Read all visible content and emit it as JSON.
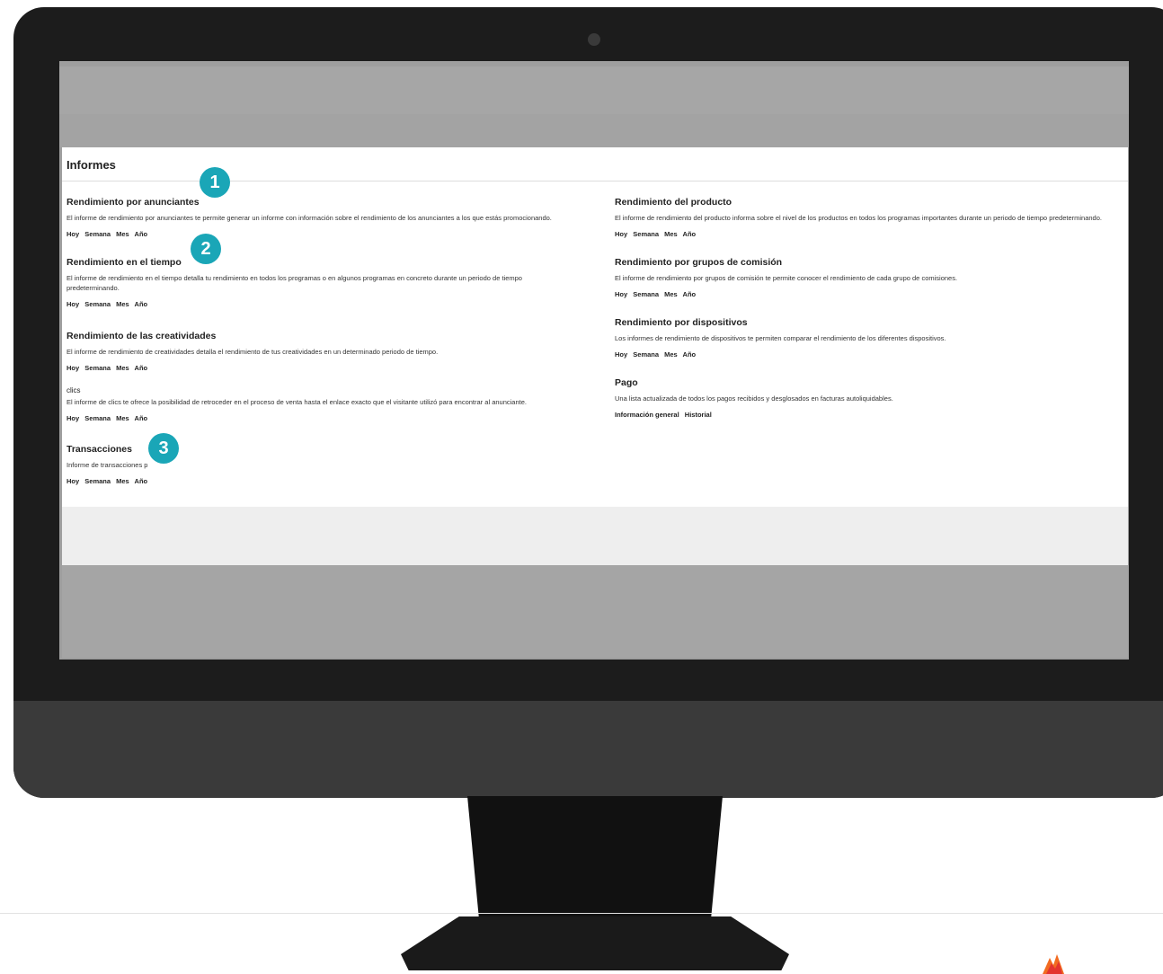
{
  "colors": {
    "callout": "#1aa6b7",
    "monitor_bezel": "#1c1c1c",
    "screen_gray": "#9e9e9e"
  },
  "page": {
    "title": "Informes"
  },
  "left_sections": [
    {
      "title": "Rendimiento por anunciantes",
      "desc": "El informe de rendimiento por anunciantes te permite generar un informe con información sobre el rendimiento de los anunciantes a los que estás promocionando.",
      "links": [
        "Hoy",
        "Semana",
        "Mes",
        "Año"
      ]
    },
    {
      "title": "Rendimiento en el tiempo",
      "desc": "El informe de rendimiento en el tiempo detalla tu rendimiento en todos los programas o en algunos programas en concreto durante un periodo de tiempo predeterminando.",
      "links": [
        "Hoy",
        "Semana",
        "Mes",
        "Año"
      ]
    },
    {
      "title": "Rendimiento de las creatividades",
      "desc": "El informe de rendimiento de creatividades detalla el rendimiento de tus creatividades en un determinado periodo de tiempo.",
      "links": [
        "Hoy",
        "Semana",
        "Mes",
        "Año"
      ]
    },
    {
      "title": "clics",
      "desc": "El informe de clics te ofrece la posibilidad de retroceder en el proceso de venta hasta el enlace exacto que el visitante utilizó para encontrar al anunciante.",
      "links": [
        "Hoy",
        "Semana",
        "Mes",
        "Año"
      ]
    },
    {
      "title": "Transacciones",
      "desc": "Informe de transacciones p",
      "links": [
        "Hoy",
        "Semana",
        "Mes",
        "Año"
      ]
    }
  ],
  "right_sections": [
    {
      "title": "Rendimiento del producto",
      "desc": "El informe de rendimiento del producto informa sobre el nivel de los productos en todos los programas importantes durante un periodo de tiempo predeterminando.",
      "links": [
        "Hoy",
        "Semana",
        "Mes",
        "Año"
      ]
    },
    {
      "title": "Rendimiento por grupos de comisión",
      "desc": "El informe de rendimiento por grupos de comisión te permite conocer el rendimiento de cada grupo de comisiones.",
      "links": [
        "Hoy",
        "Semana",
        "Mes",
        "Año"
      ]
    },
    {
      "title": "Rendimiento por dispositivos",
      "desc": "Los informes de rendimiento de dispositivos te permiten comparar el rendimiento de los diferentes dispositivos.",
      "links": [
        "Hoy",
        "Semana",
        "Mes",
        "Año"
      ]
    },
    {
      "title": "Pago",
      "desc": "Una lista actualizada de todos los pagos recibidos y desglosados en facturas autoliquidables.",
      "links": [
        "Información general",
        "Historial"
      ]
    }
  ],
  "callouts": [
    "1",
    "2",
    "3"
  ]
}
